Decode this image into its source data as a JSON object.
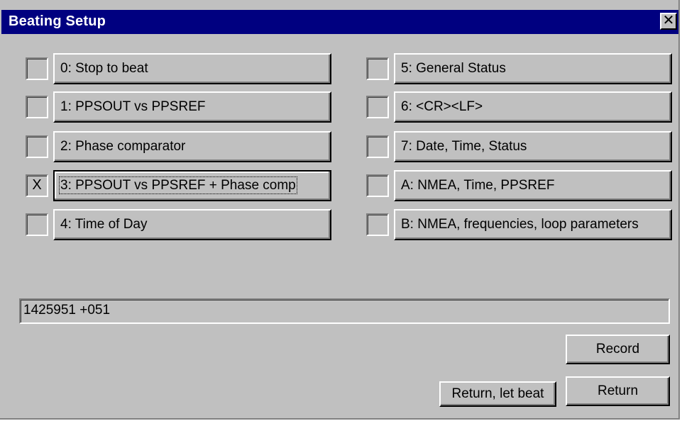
{
  "window": {
    "title": "Beating Setup",
    "close_glyph": "✕"
  },
  "left_options": [
    {
      "checked": "",
      "label": "0: Stop to beat"
    },
    {
      "checked": "",
      "label": "1: PPSOUT vs PPSREF"
    },
    {
      "checked": "",
      "label": "2: Phase comparator"
    },
    {
      "checked": "X",
      "label": "3: PPSOUT vs PPSREF + Phase comp"
    },
    {
      "checked": "",
      "label": "4: Time of Day"
    }
  ],
  "right_options": [
    {
      "checked": "",
      "label": "5: General Status"
    },
    {
      "checked": "",
      "label": "6: <CR><LF>"
    },
    {
      "checked": "",
      "label": "7: Date, Time, Status"
    },
    {
      "checked": "",
      "label": "A: NMEA, Time, PPSREF"
    },
    {
      "checked": "",
      "label": "B: NMEA, frequencies, loop parameters"
    }
  ],
  "output": {
    "value": "1425951 +051"
  },
  "buttons": {
    "record": "Record",
    "return_let_beat": "Return, let beat",
    "return": "Return"
  },
  "colors": {
    "face": "#c0c0c0",
    "titlebar": "#000080",
    "title_text": "#ffffff"
  }
}
